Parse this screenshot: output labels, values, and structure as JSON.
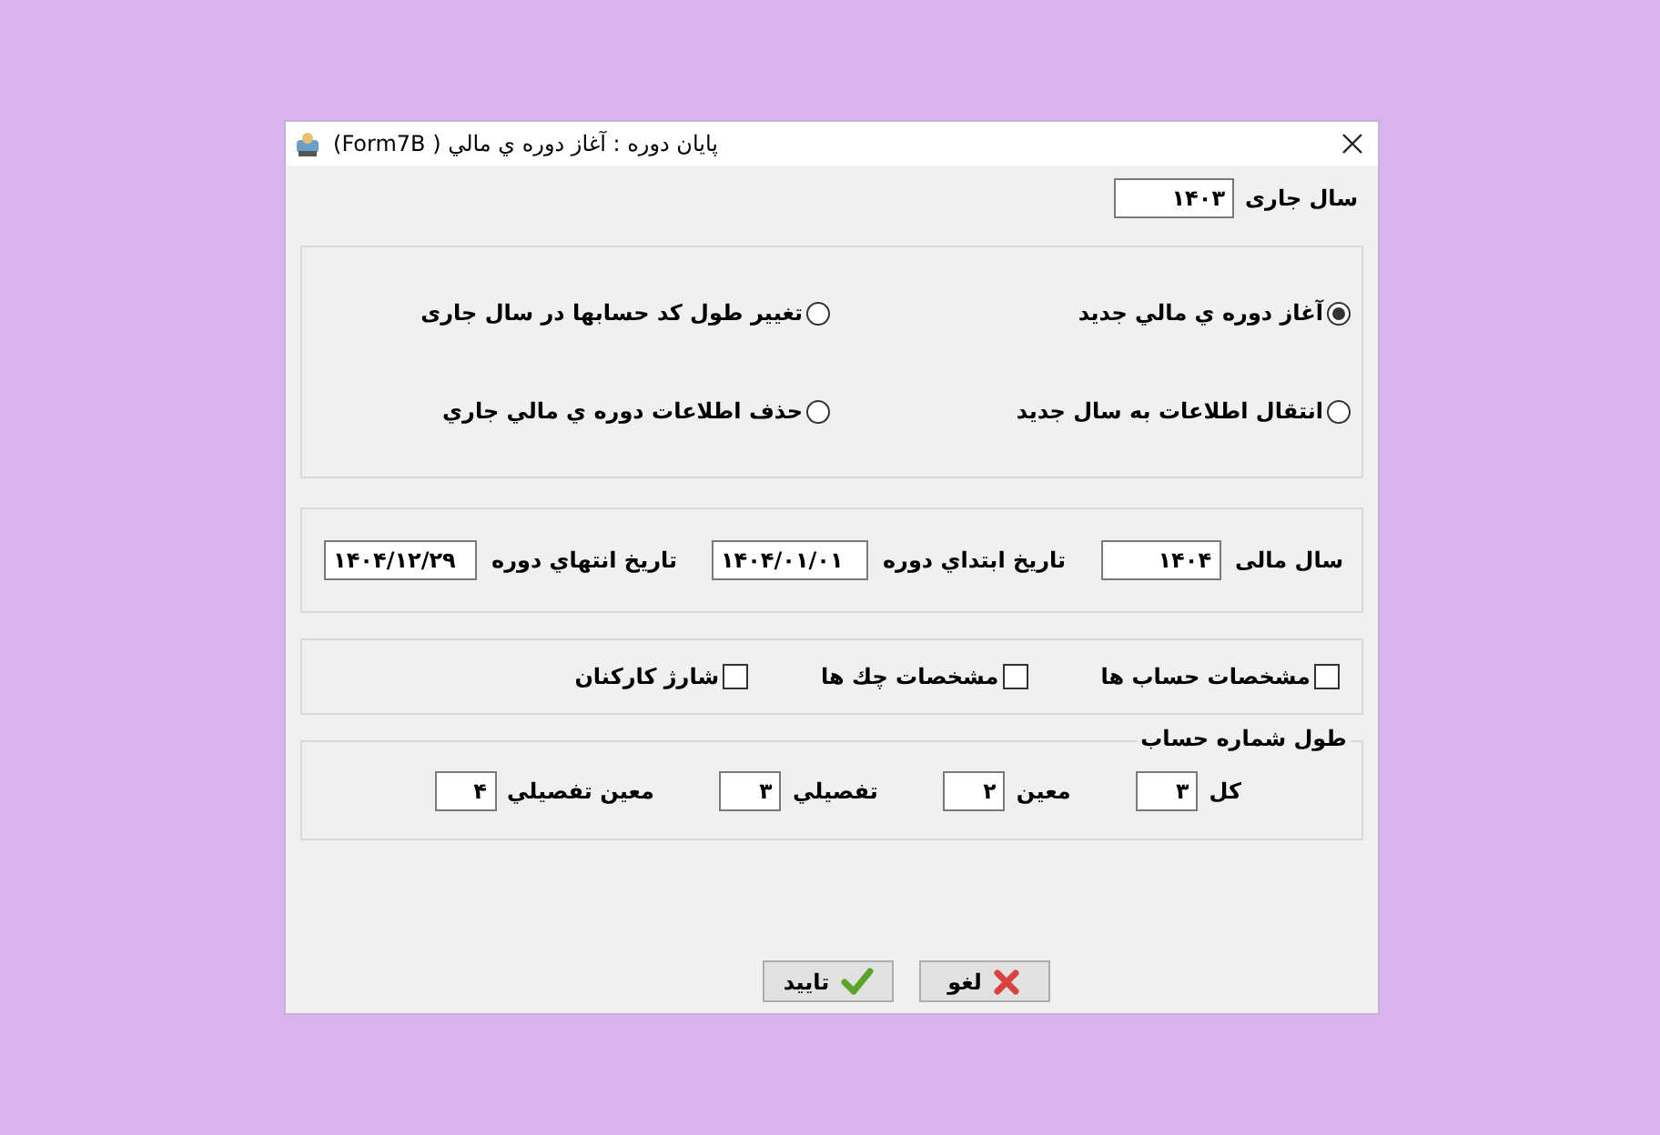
{
  "window": {
    "title": "پايان دوره : آغاز دوره ي مالي ( Form7B)"
  },
  "current_year": {
    "label": "سال جاری",
    "value": "۱۴۰۳"
  },
  "operations": [
    {
      "label": "آغاز دوره ي مالي جديد",
      "selected": true
    },
    {
      "label": "تغيير طول كد حسابها در سال جاری",
      "selected": false
    },
    {
      "label": "انتقال اطلاعات به سال جديد",
      "selected": false
    },
    {
      "label": "حذف اطلاعات دوره ي مالي جاري",
      "selected": false
    }
  ],
  "period_fields": [
    {
      "label": "سال مالی",
      "value": "۱۴۰۴"
    },
    {
      "label": "تاريخ ابتداي دوره",
      "value": "۱۴۰۴/۰۱/۰۱"
    },
    {
      "label": "تاريخ انتهاي دوره",
      "value": "۱۴۰۴/۱۲/۲۹"
    }
  ],
  "copy_options": [
    {
      "label": "مشخصات حساب ها",
      "checked": false
    },
    {
      "label": "مشخصات چك ها",
      "checked": false
    },
    {
      "label": "شارژ كاركنان",
      "checked": false
    }
  ],
  "account_length": {
    "title": "طول شماره حساب",
    "fields": [
      {
        "label": "كل",
        "value": "۳"
      },
      {
        "label": "معين",
        "value": "۲"
      },
      {
        "label": "تفصيلي",
        "value": "۳"
      },
      {
        "label": "معين تفصيلي",
        "value": "۴"
      }
    ]
  },
  "buttons": [
    {
      "label": "لغو",
      "kind": "cancel"
    },
    {
      "label": "تاييد",
      "kind": "ok"
    }
  ]
}
